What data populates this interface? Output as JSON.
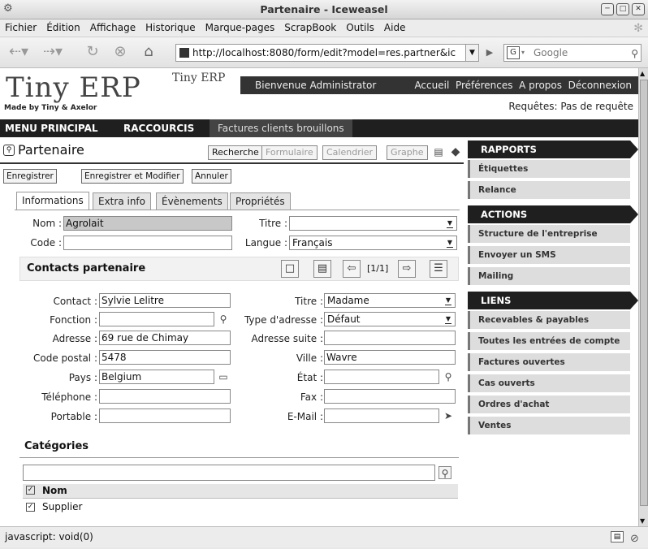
{
  "window": {
    "title": "Partenaire - Iceweasel"
  },
  "menubar": [
    "Fichier",
    "Édition",
    "Affichage",
    "Historique",
    "Marque-pages",
    "ScrapBook",
    "Outils",
    "Aide"
  ],
  "navbar": {
    "url": "http://localhost:8080/form/edit?model=res.partner&ic",
    "search_placeholder": "Google"
  },
  "header": {
    "logo_text": "Tiny ERP",
    "logo_made_by": "Made by Tiny & Axelor",
    "small_logo": "Tiny ERP",
    "welcome": "Bienvenue Administrator",
    "links": [
      "Accueil",
      "Préférences",
      "A propos",
      "Déconnexion"
    ],
    "requests": "Requêtes: Pas de requête"
  },
  "mainmenu": {
    "menu_principal": "MENU PRINCIPAL",
    "raccourcis": "RACCOURCIS",
    "shortcut": "Factures clients brouillons"
  },
  "form": {
    "title": "Partenaire",
    "views": [
      "Recherche",
      "Formulaire",
      "Calendrier",
      "Graphe"
    ],
    "actions": [
      "Enregistrer",
      "Enregistrer et Modifier",
      "Annuler"
    ],
    "tabs": [
      "Informations",
      "Extra info",
      "Évènements",
      "Propriétés"
    ],
    "nom_label": "Nom :",
    "nom_value": "Agrolait",
    "titre_label": "Titre :",
    "titre_value": "",
    "code_label": "Code :",
    "code_value": "",
    "langue_label": "Langue :",
    "langue_value": "Français"
  },
  "contacts": {
    "title": "Contacts partenaire",
    "pager": "[1/1]",
    "contact_label": "Contact :",
    "contact_value": "Sylvie Lelitre",
    "titre_label": "Titre :",
    "titre_value": "Madame",
    "fonction_label": "Fonction :",
    "fonction_value": "",
    "type_label": "Type d'adresse :",
    "type_value": "Défaut",
    "adresse_label": "Adresse :",
    "adresse_value": "69 rue de Chimay",
    "adresse_suite_label": "Adresse suite :",
    "adresse_suite_value": "",
    "cp_label": "Code postal :",
    "cp_value": "5478",
    "ville_label": "Ville :",
    "ville_value": "Wavre",
    "pays_label": "Pays :",
    "pays_value": "Belgium",
    "etat_label": "État :",
    "etat_value": "",
    "tel_label": "Téléphone :",
    "tel_value": "",
    "fax_label": "Fax :",
    "fax_value": "",
    "portable_label": "Portable :",
    "portable_value": "",
    "email_label": "E-Mail :",
    "email_value": ""
  },
  "categories": {
    "title": "Catégories",
    "search_value": "",
    "column": "Nom",
    "rows": [
      "Supplier"
    ]
  },
  "sidebar": {
    "rapports_title": "RAPPORTS",
    "rapports": [
      "Étiquettes",
      "Relance"
    ],
    "actions_title": "ACTIONS",
    "actions": [
      "Structure de l'entreprise",
      "Envoyer un SMS",
      "Mailing"
    ],
    "liens_title": "LIENS",
    "liens": [
      "Recevables & payables",
      "Toutes les entrées de compte",
      "Factures ouvertes",
      "Cas ouverts",
      "Ordres d'achat",
      "Ventes"
    ]
  },
  "status": {
    "text": "javascript: void(0)"
  },
  "colors": {
    "dark_bar": "#1f1f1f",
    "sidebar_item_bg": "#dddddd",
    "readonly_field": "#c8c8c8"
  }
}
